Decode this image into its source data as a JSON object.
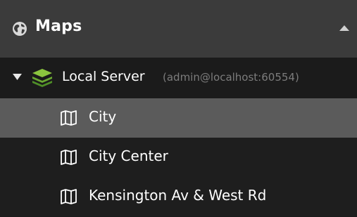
{
  "header": {
    "title": "Maps",
    "icon": "globe-icon",
    "collapse_icon": "chevron-up-icon"
  },
  "tree": {
    "server": {
      "label": "Local Server",
      "connection": "(admin@localhost:60554)",
      "icon": "layers-icon",
      "expanded": true
    },
    "maps": [
      {
        "label": "City",
        "icon": "map-icon",
        "selected": true
      },
      {
        "label": "City Center",
        "icon": "map-icon",
        "selected": false
      },
      {
        "label": "Kensington Av & West Rd",
        "icon": "map-icon",
        "selected": false
      }
    ]
  },
  "colors": {
    "header_bg": "#3b3b3b",
    "panel_bg": "#1b1b1b",
    "selected_bg": "#5b5b5b",
    "layers_green": "#6db33f",
    "text": "#ffffff",
    "subtext": "#7c7c7c"
  }
}
